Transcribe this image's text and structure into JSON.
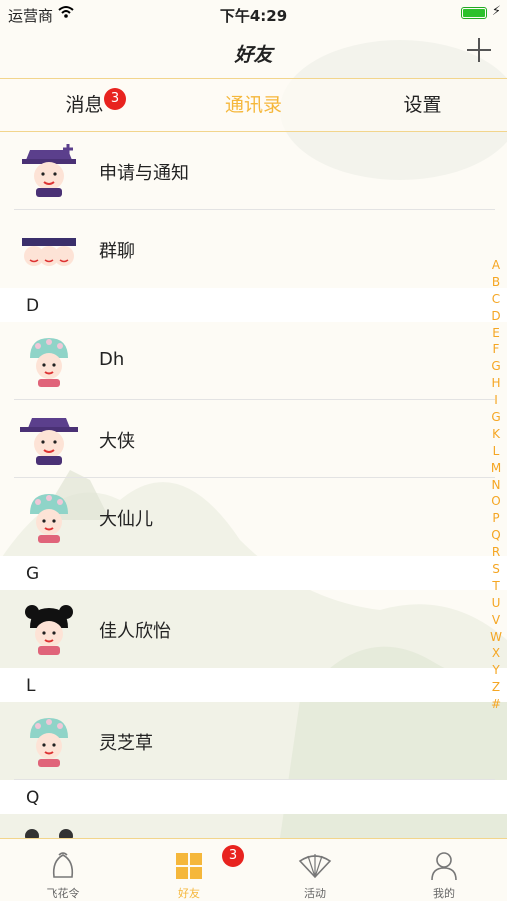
{
  "status_bar": {
    "carrier": "运营商",
    "time": "下午4:29"
  },
  "nav": {
    "title": "好友"
  },
  "tabs": [
    {
      "label": "消息",
      "badge": "3"
    },
    {
      "label": "通讯录"
    },
    {
      "label": "设置"
    }
  ],
  "top_items": [
    {
      "name": "申请与通知",
      "icon": "official-hat-plus-icon"
    },
    {
      "name": "群聊",
      "icon": "group-avatars-icon"
    }
  ],
  "sections": [
    {
      "letter": "D",
      "contacts": [
        {
          "name": "Dh",
          "icon": "opera-crown-avatar"
        },
        {
          "name": "大侠",
          "icon": "official-hat-avatar"
        },
        {
          "name": "大仙儿",
          "icon": "opera-crown-avatar"
        }
      ]
    },
    {
      "letter": "G",
      "contacts": [
        {
          "name": "佳人欣怡",
          "icon": "girl-avatar"
        }
      ]
    },
    {
      "letter": "L",
      "contacts": [
        {
          "name": "灵芝草",
          "icon": "opera-crown-avatar"
        }
      ]
    },
    {
      "letter": "Q",
      "contacts": []
    }
  ],
  "index_letters": [
    "A",
    "B",
    "C",
    "D",
    "E",
    "F",
    "G",
    "H",
    "I",
    "G",
    "K",
    "L",
    "M",
    "N",
    "O",
    "P",
    "Q",
    "R",
    "S",
    "T",
    "U",
    "V",
    "W",
    "X",
    "Y",
    "Z",
    "#"
  ],
  "tabbar": [
    {
      "label": "飞花令",
      "icon": "bun-icon"
    },
    {
      "label": "好友",
      "icon": "grid-icon",
      "badge": "3"
    },
    {
      "label": "活动",
      "icon": "fan-icon"
    },
    {
      "label": "我的",
      "icon": "person-icon"
    }
  ],
  "colors": {
    "accent": "#f5b73b",
    "badge": "#e8231f",
    "index": "#f5a623",
    "divider": "#f2d58c"
  }
}
